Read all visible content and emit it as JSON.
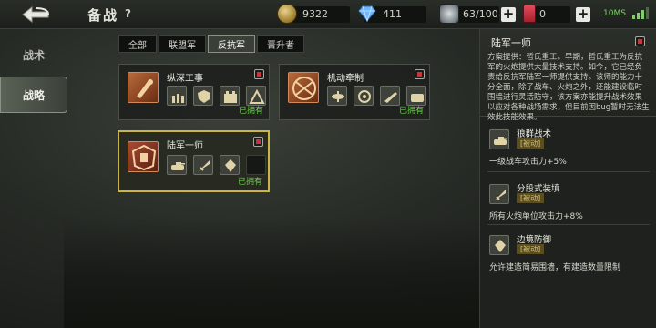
{
  "header": {
    "title": "备战",
    "help": "?",
    "gold": "9322",
    "gems": "411",
    "ammo": "63/100",
    "cards": "0",
    "status": "10MS",
    "plus": "+"
  },
  "nav": {
    "items": [
      {
        "label": "战术"
      },
      {
        "label": "战略"
      }
    ]
  },
  "tabs": [
    {
      "label": "全部"
    },
    {
      "label": "联盟军"
    },
    {
      "label": "反抗军"
    },
    {
      "label": "晋升者"
    }
  ],
  "cards": [
    {
      "name": "纵深工事",
      "owned": "已拥有"
    },
    {
      "name": "机动牵制",
      "owned": "已拥有"
    },
    {
      "name": "陆军一师",
      "owned": "已拥有"
    }
  ],
  "detail": {
    "title": "陆军一师",
    "description": "方案提供：哲氏重工。早期，哲氏重工为反抗军的火炮提供大量技术支持。如今，它已经负责给反抗军陆军一师提供支持。该师的能力十分全面，除了战车、火炮之外，还能建设临时围墙进行灵活防守，该方案亦能提升战术效果以应对各种战场需求，但目前因bug暂时无法生效此技能效果。",
    "tactics": [
      {
        "name": "狼群战术",
        "tag": "[被动]",
        "effect": "一级战车攻击力+5%"
      },
      {
        "name": "分段式装填",
        "tag": "[被动]",
        "effect": "所有火炮单位攻击力+8%"
      },
      {
        "name": "边境防御",
        "tag": "[被动]",
        "effect": "允许建造简易围墙，有建造数量限制"
      }
    ]
  },
  "colors": {
    "accent_gold": "#c9b54a",
    "owned_green": "#66cc44",
    "emblem_orange": "#b86a3a"
  }
}
